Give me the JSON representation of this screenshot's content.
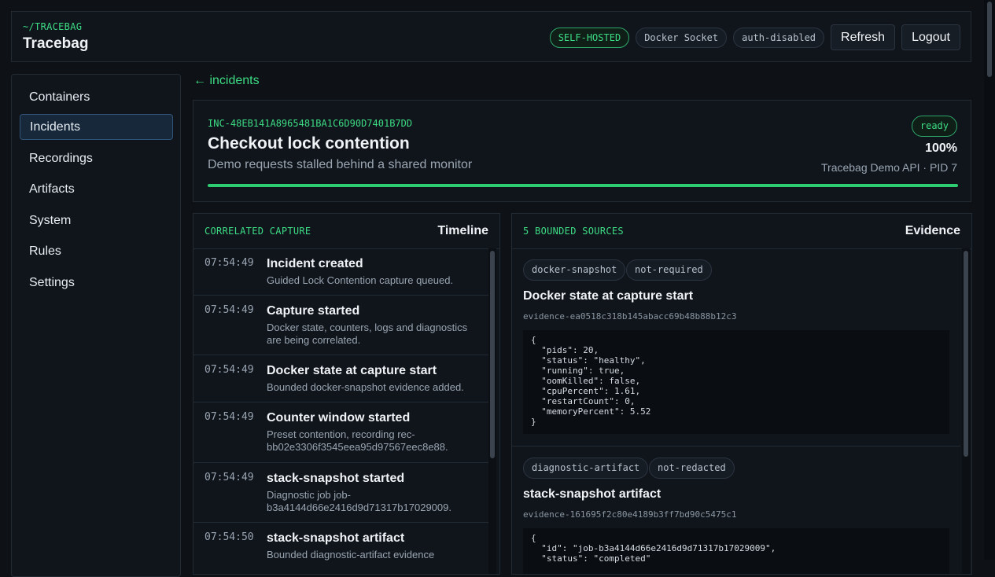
{
  "brand": {
    "path": "~/TRACEBAG",
    "title": "Tracebag"
  },
  "header": {
    "badges": [
      "SELF-HOSTED",
      "Docker Socket",
      "auth-disabled"
    ],
    "refresh_label": "Refresh",
    "logout_label": "Logout"
  },
  "sidebar": {
    "items": [
      {
        "label": "Containers"
      },
      {
        "label": "Incidents",
        "active": true
      },
      {
        "label": "Recordings"
      },
      {
        "label": "Artifacts"
      },
      {
        "label": "System"
      },
      {
        "label": "Rules"
      },
      {
        "label": "Settings"
      }
    ]
  },
  "back_link": "← incidents",
  "incident": {
    "id": "INC-48EB141A8965481BA1C6D90D7401B7DD",
    "title": "Checkout lock contention",
    "subtitle": "Demo requests stalled behind a shared monitor",
    "status": "ready",
    "progress_label": "100%",
    "progress": 1.0,
    "meta": "Tracebag Demo API · PID 7"
  },
  "timeline": {
    "eyebrow": "CORRELATED CAPTURE",
    "title": "Timeline",
    "events": [
      {
        "time": "07:54:49",
        "title": "Incident created",
        "desc": "Guided Lock Contention capture queued."
      },
      {
        "time": "07:54:49",
        "title": "Capture started",
        "desc": "Docker state, counters, logs and diagnostics are being correlated."
      },
      {
        "time": "07:54:49",
        "title": "Docker state at capture start",
        "desc": "Bounded docker-snapshot evidence added."
      },
      {
        "time": "07:54:49",
        "title": "Counter window started",
        "desc": "Preset contention, recording rec-bb02e3306f3545eea95d97567eec8e88."
      },
      {
        "time": "07:54:49",
        "title": "stack-snapshot started",
        "desc": "Diagnostic job job-b3a4144d66e2416d9d71317b17029009."
      },
      {
        "time": "07:54:50",
        "title": "stack-snapshot artifact",
        "desc": "Bounded diagnostic-artifact evidence"
      }
    ]
  },
  "evidence": {
    "eyebrow": "5 BOUNDED SOURCES",
    "title": "Evidence",
    "items": [
      {
        "tags": [
          "docker-snapshot",
          "not-required"
        ],
        "title": "Docker state at capture start",
        "id": "evidence-ea0518c318b145abacc69b48b88b12c3",
        "code": "{\n  \"pids\": 20,\n  \"status\": \"healthy\",\n  \"running\": true,\n  \"oomKilled\": false,\n  \"cpuPercent\": 1.61,\n  \"restartCount\": 0,\n  \"memoryPercent\": 5.52\n}"
      },
      {
        "tags": [
          "diagnostic-artifact",
          "not-redacted"
        ],
        "title": "stack-snapshot artifact",
        "id": "evidence-161695f2c80e4189b3ff7bd90c5475c1",
        "code": "{\n  \"id\": \"job-b3a4144d66e2416d9d71317b17029009\",\n  \"status\": \"completed\""
      }
    ]
  },
  "colors": {
    "accent": "#3ddc84",
    "background": "#0e1116",
    "panel": "#10151c"
  }
}
